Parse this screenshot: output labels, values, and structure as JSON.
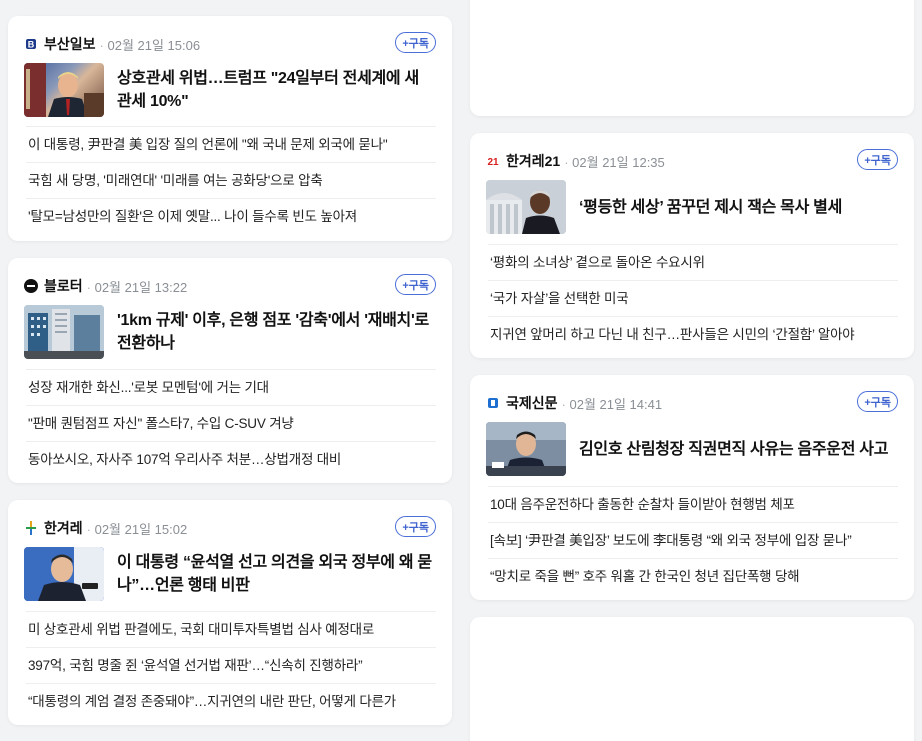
{
  "subscribe_label": "+구독",
  "colors": {
    "accent": "#3f64cf",
    "busan": "#1d3a8a",
    "hankyoreh21": "#d81e1e",
    "bloter": "#111111",
    "hankyoreh": "#2a9d4a",
    "kookje": "#1d6fd1"
  },
  "cards": [
    {
      "press": "부산일보",
      "date": "02월 21일 15:06",
      "logo_icon": "busan-ilbo-logo-icon",
      "main_title": "상호관세 위법…트럼프 \"24일부터 전세계에 새 관세 10%\"",
      "thumb_icon": "trump-photo-thumbnail",
      "items": [
        "이 대통령, 尹판결 美 입장 질의 언론에 \"왜 국내 문제 외국에 묻나\"",
        "국힘 새 당명, '미래연대' '미래를 여는 공화당'으로 압축",
        "'탈모=남성만의 질환'은 이제 옛말... 나이 들수록 빈도 높아져"
      ]
    },
    {
      "press": "블로터",
      "date": "02월 21일 13:22",
      "logo_icon": "bloter-logo-icon",
      "main_title": "'1km 규제' 이후, 은행 점포 '감축'에서 '재배치'로 전환하나",
      "thumb_icon": "bank-buildings-thumbnail",
      "items": [
        "성장 재개한 화신...'로봇 모멘텀'에 거는 기대",
        "\"판매 퀀텀점프 자신\" 폴스타7, 수입 C-SUV 겨냥",
        "동아쏘시오, 자사주 107억 우리사주 처분…상법개정 대비"
      ]
    },
    {
      "press": "한겨레",
      "date": "02월 21일 15:02",
      "logo_icon": "hankyoreh-logo-icon",
      "main_title": "이 대통령 “윤석열 선고 의견을 외국 정부에 왜 묻나”…언론 행태 비판",
      "thumb_icon": "president-photo-thumbnail",
      "items": [
        "미 상호관세 위법 판결에도, 국회 대미투자특별법 심사 예정대로",
        "397억, 국힘 명줄 쥔 ‘윤석열 선거법 재판’…“신속히 진행하라”",
        "“대통령의 계엄 결정 존중돼야”…지귀연의 내란 판단, 어떻게 다른가"
      ]
    },
    {
      "press": "한겨레21",
      "date": "02월 21일 12:35",
      "logo_icon": "hankyoreh21-logo-icon",
      "main_title": "‘평등한 세상’ 꿈꾸던 제시 잭슨 목사 별세",
      "thumb_icon": "jesse-jackson-photo-thumbnail",
      "items": [
        "‘평화의 소녀상’ 곁으로 돌아온 수요시위",
        "‘국가 자살’을 선택한 미국",
        "지귀연 앞머리 하고 다닌 내 친구…판사들은 시민의 ‘간절함’ 알아야"
      ]
    },
    {
      "press": "국제신문",
      "date": "02월 21일 14:41",
      "logo_icon": "kookje-logo-icon",
      "main_title": "김인호 산림청장 직권면직 사유는 음주운전 사고",
      "thumb_icon": "official-photo-thumbnail",
      "items": [
        "10대 음주운전하다 출동한 순찰차 들이받아 현행범 체포",
        "[속보] ‘尹판결 美입장’ 보도에 李대통령 “왜 외국 정부에 입장 묻나”",
        "“망치로 죽을 뻔” 호주 워홀 간 한국인 청년 집단폭행 당해"
      ]
    }
  ]
}
